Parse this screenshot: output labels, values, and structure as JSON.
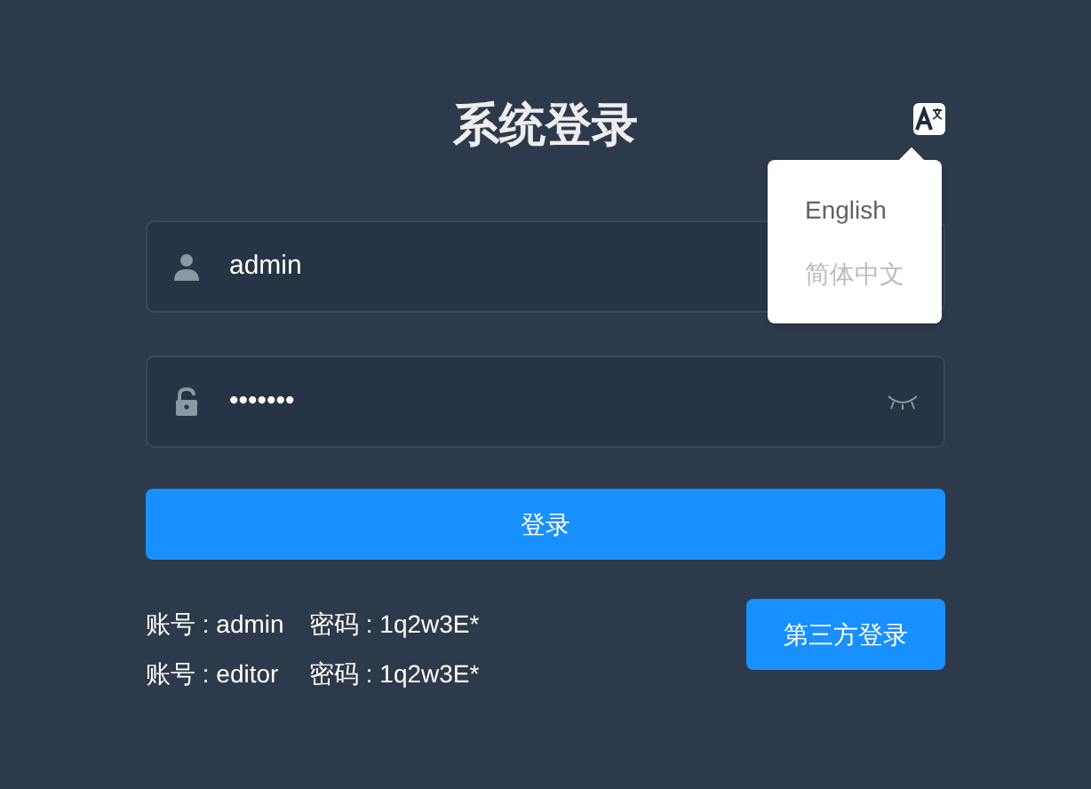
{
  "title": "系统登录",
  "language_menu": {
    "items": [
      {
        "label": "English",
        "disabled": false
      },
      {
        "label": "简体中文",
        "disabled": true
      }
    ]
  },
  "username": {
    "value": "admin"
  },
  "password": {
    "value": "•••••••"
  },
  "login_button": "登录",
  "credentials": [
    {
      "account_label": "账号 : admin",
      "password_label": "密码 : 1q2w3E*"
    },
    {
      "account_label": "账号 : editor",
      "password_label": "密码 : 1q2w3E*"
    }
  ],
  "third_party_button": "第三方登录"
}
